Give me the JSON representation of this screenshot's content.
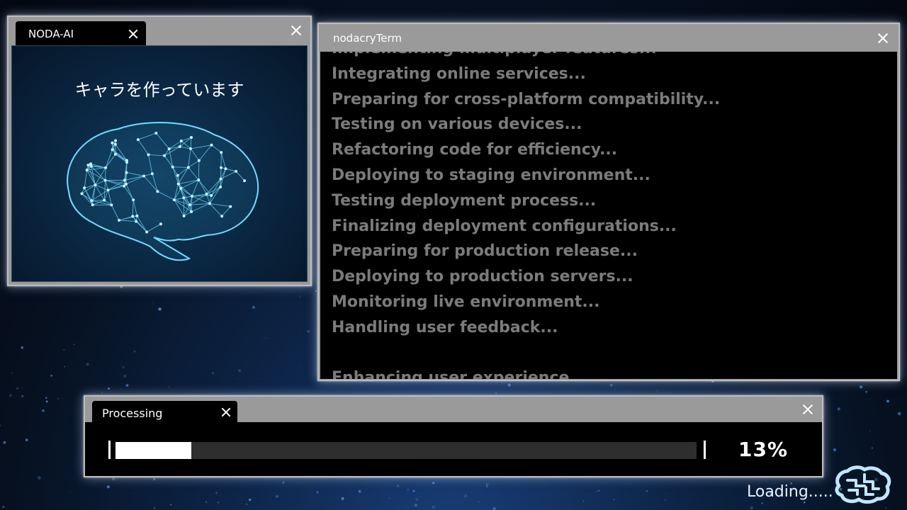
{
  "ai_window": {
    "tab_title": "NODA-AI",
    "caption": "キャラを作っています",
    "image": "wireframe-brain-illustration"
  },
  "terminal": {
    "title": "nodacryTerm",
    "lines": [
      "Implementing multiplayer features...",
      "Integrating online services...",
      "Preparing for cross-platform compatibility...",
      "Testing on various devices...",
      "Refactoring code for efficiency...",
      "Deploying to staging environment...",
      "Testing deployment process...",
      "Finalizing deployment configurations...",
      "Preparing for production release...",
      "Deploying to production servers...",
      "Monitoring live environment...",
      "Handling user feedback...",
      "",
      "Enhancing user experience..."
    ]
  },
  "processing": {
    "tab_title": "Processing",
    "progress_percent": 13,
    "progress_label": "13%"
  },
  "footer": {
    "loading_text": "Loading.....",
    "logo_icon": "circuit-brain-icon"
  },
  "colors": {
    "window_frame": "#9a9a9a",
    "terminal_text": "#7b7b7b",
    "accent_cyan": "#7fe6ff"
  },
  "icons": {
    "close": "close-icon"
  }
}
